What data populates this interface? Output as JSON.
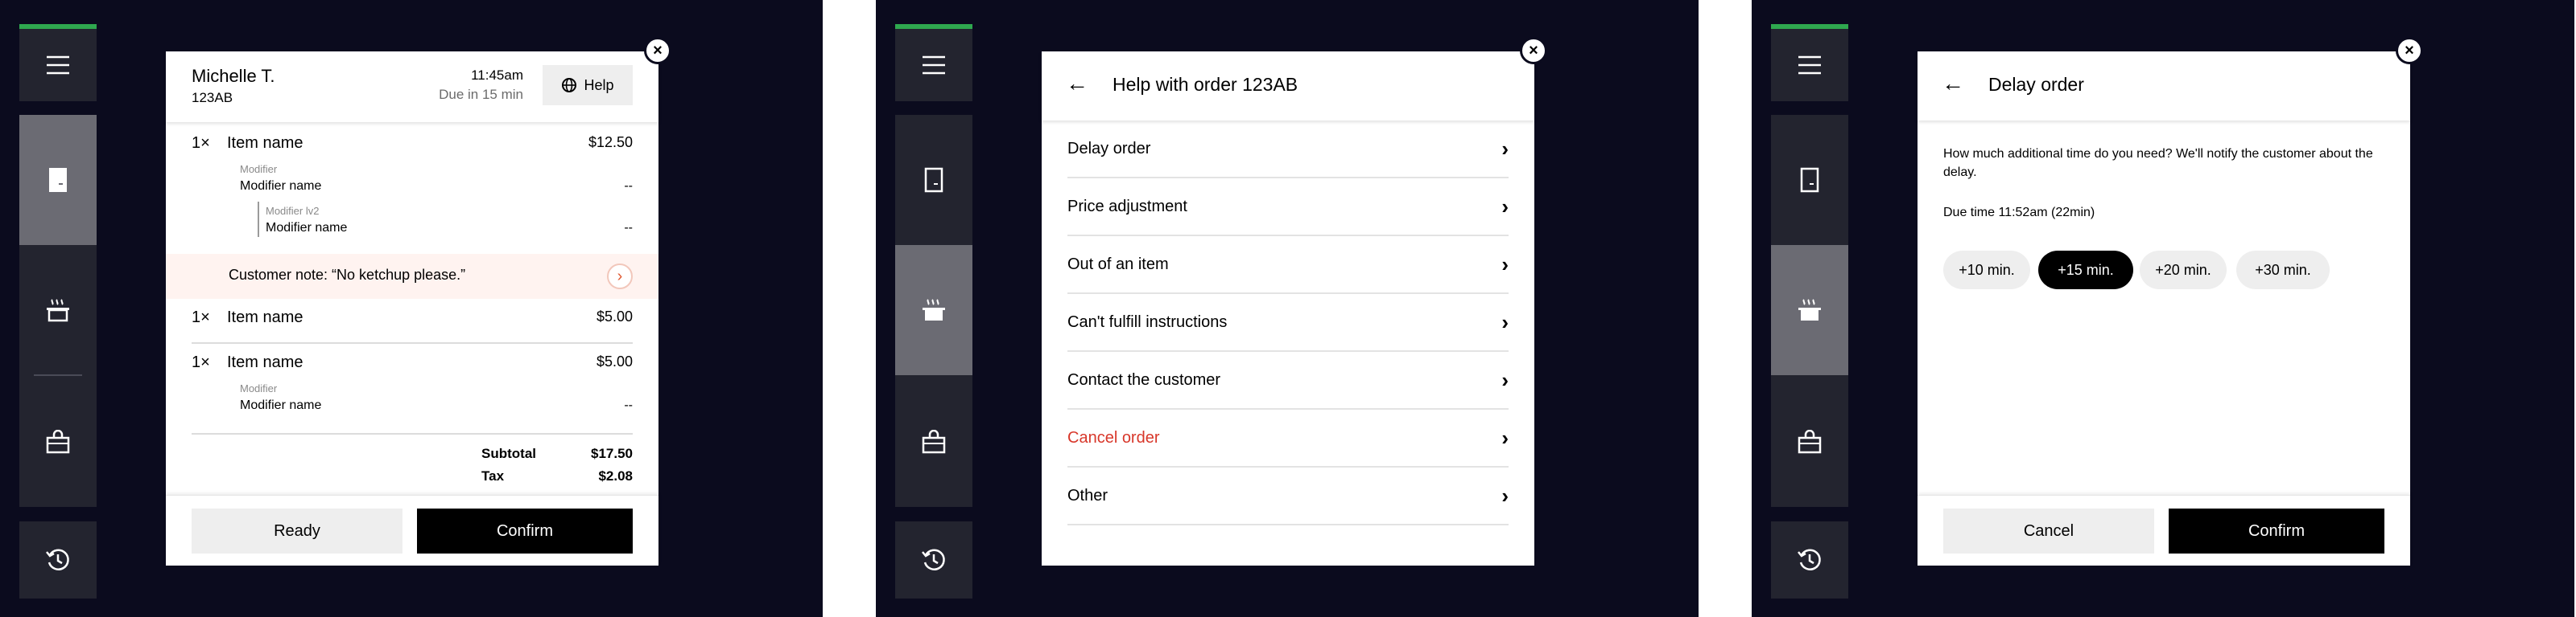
{
  "screens": [
    {
      "close": "×",
      "order": {
        "customer_name": "Michelle T.",
        "order_id": "123AB",
        "time": "11:45am",
        "due": "Due in 15 min",
        "help_label": "Help",
        "items": [
          {
            "qty": "1×",
            "name": "Item name",
            "price": "$12.50",
            "modifier_label": "Modifier",
            "modifier_name": "Modifier name",
            "modifier_value": "--",
            "sub_label": "Modifier lv2",
            "sub_name": "Modifier name",
            "sub_value": "--"
          },
          {
            "qty": "1×",
            "name": "Item name",
            "price": "$5.00"
          },
          {
            "qty": "1×",
            "name": "Item name",
            "price": "$5.00",
            "modifier_label": "Modifier",
            "modifier_name": "Modifier name",
            "modifier_value": "--"
          }
        ],
        "note": "Customer note: “No ketchup please.”",
        "subtotal_label": "Subtotal",
        "subtotal": "$17.50",
        "tax_label": "Tax",
        "tax": "$2.08",
        "ready_label": "Ready",
        "confirm_label": "Confirm"
      }
    },
    {
      "close": "×",
      "help": {
        "title": "Help with order 123AB",
        "options": [
          {
            "label": "Delay order"
          },
          {
            "label": "Price adjustment"
          },
          {
            "label": "Out of an item"
          },
          {
            "label": "Can't fulfill instructions"
          },
          {
            "label": "Contact the customer"
          },
          {
            "label": "Cancel order"
          },
          {
            "label": "Other"
          }
        ]
      }
    },
    {
      "close": "×",
      "delay": {
        "title": "Delay order",
        "description": "How much additional time do you need? We'll notify the customer about the delay.",
        "due_time": "Due time 11:52am (22min)",
        "options": [
          "+10 min.",
          "+15 min.",
          "+20 min.",
          "+30 min."
        ],
        "selected": "+15 min.",
        "cancel_label": "Cancel",
        "confirm_label": "Confirm"
      }
    }
  ],
  "sidebar": {
    "icons": [
      "menu-icon",
      "receipt-icon",
      "cooking-pot-icon",
      "shopping-bag-icon",
      "history-icon"
    ],
    "active_per_screen": [
      "receipt-icon",
      "cooking-pot-icon",
      "cooking-pot-icon"
    ]
  },
  "colors": {
    "background": "#0b0b1e",
    "sidebar": "#23242f",
    "sidebar_active": "#6b6b73",
    "accent_green": "#2fa84f",
    "danger": "#d8372a",
    "note_bg": "#fff3f0"
  }
}
